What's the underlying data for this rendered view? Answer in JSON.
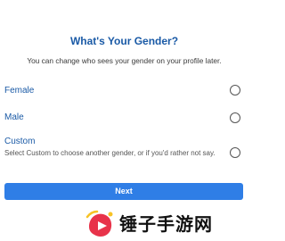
{
  "header": {
    "title": "What's Your Gender?",
    "subtitle": "You can change who sees your gender on your profile later."
  },
  "options": [
    {
      "label": "Female",
      "selected": false
    },
    {
      "label": "Male",
      "selected": false
    },
    {
      "label": "Custom",
      "description": "Select Custom to choose another gender, or if you'd rather not say.",
      "selected": false
    }
  ],
  "actions": {
    "next_label": "Next"
  },
  "watermark": {
    "text": "锤子手游网",
    "logo_colors": [
      "#e8334a",
      "#f7c325"
    ]
  },
  "colors": {
    "title": "#1a5aa6",
    "button": "#2f7ee6"
  }
}
